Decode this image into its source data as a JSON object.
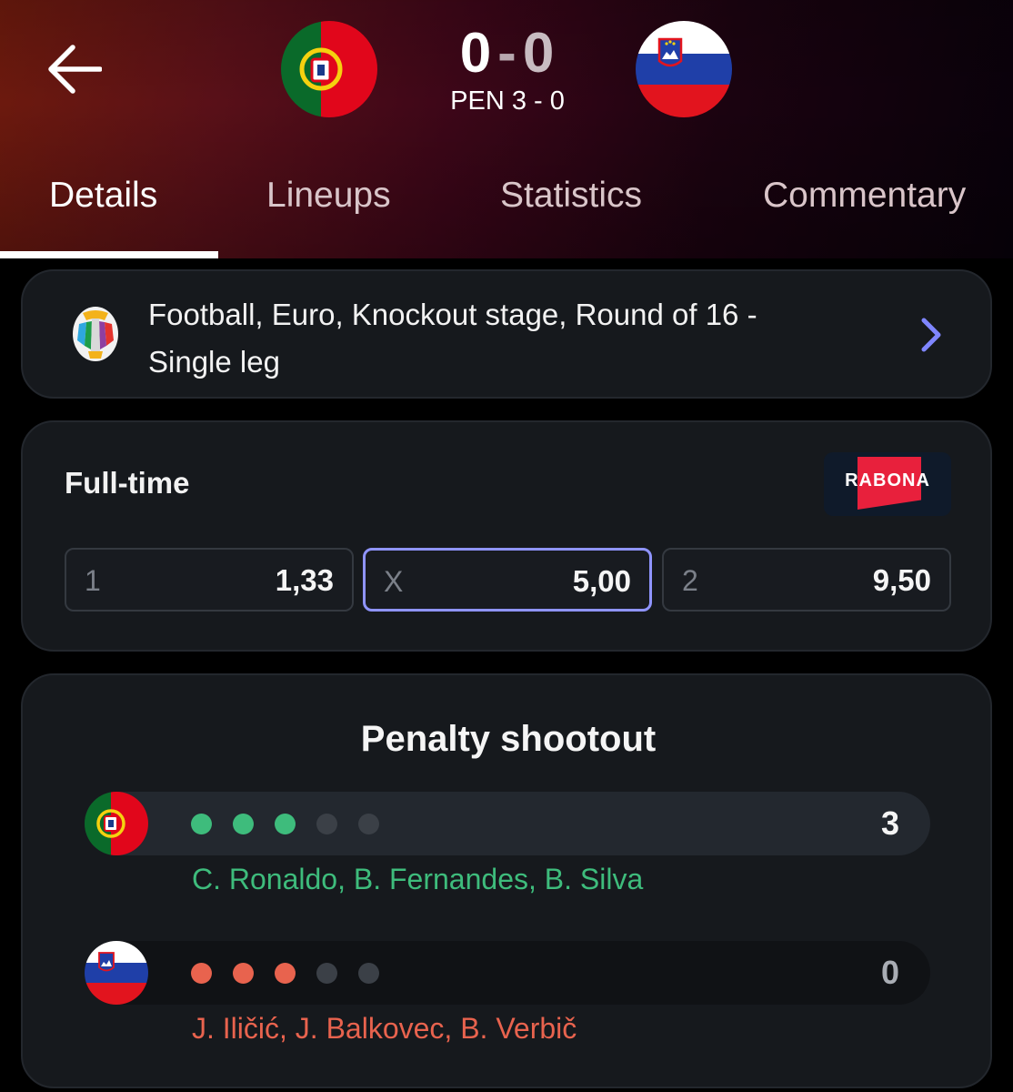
{
  "header": {
    "back_icon": "arrow-left-icon",
    "home_team": {
      "flag": "portugal-flag",
      "score": "0"
    },
    "away_team": {
      "flag": "slovenia-flag",
      "score": "0"
    },
    "score_separator": "-",
    "penalties_text": "PEN 3 - 0"
  },
  "tabs": [
    {
      "label": "Details",
      "active": true
    },
    {
      "label": "Lineups",
      "active": false
    },
    {
      "label": "Statistics",
      "active": false
    },
    {
      "label": "Commentary",
      "active": false
    }
  ],
  "competition": {
    "logo": "euro-trophy-logo",
    "text": "Football, Euro, Knockout stage, Round of 16 - Single leg",
    "chevron_icon": "chevron-right-icon",
    "accent_color": "#7f86ff"
  },
  "odds": {
    "label": "Full-time",
    "bookmaker": "RABONA",
    "bookmaker_color": "#e8203c",
    "items": [
      {
        "key": "1",
        "value": "1,33",
        "selected": false
      },
      {
        "key": "X",
        "value": "5,00",
        "selected": true
      },
      {
        "key": "2",
        "value": "9,50",
        "selected": false
      }
    ]
  },
  "penalty_shootout": {
    "title": "Penalty shootout",
    "home": {
      "flag": "portugal-flag",
      "attempts": [
        "scored",
        "scored",
        "scored",
        "pending",
        "pending"
      ],
      "total": "3",
      "players": "C. Ronaldo, B. Fernandes, B. Silva",
      "color": "#3ebc7c"
    },
    "away": {
      "flag": "slovenia-flag",
      "attempts": [
        "missed",
        "missed",
        "missed",
        "pending",
        "pending"
      ],
      "total": "0",
      "players": "J. Iličić, J. Balkovec, B. Verbič",
      "color": "#e8634e"
    }
  }
}
